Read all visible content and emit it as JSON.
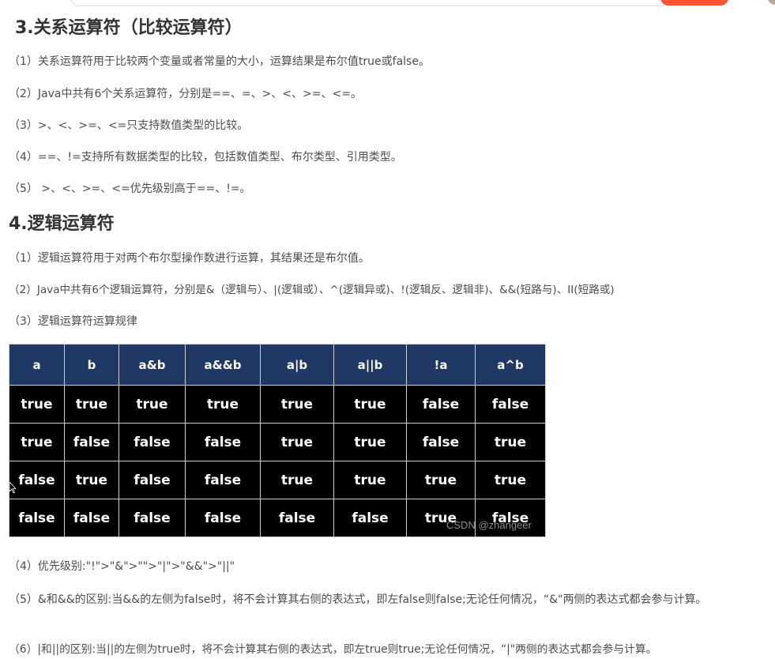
{
  "section3": {
    "heading": "3.关系运算符（比较运算符）",
    "points": [
      "（1）关系运算符用于比较两个变量或者常量的大小，运算结果是布尔值true或false。",
      "（2）Java中共有6个关系运算符，分别是==、=、>、<、>=、<=。",
      "（3）>、<、>=、<=只支持数值类型的比较。",
      "（4）==、!=支持所有数据类型的比较，包括数值类型、布尔类型、引用类型。",
      "（5） >、<、>=、<=优先级别高于==、!=。"
    ]
  },
  "section4": {
    "heading": "4.逻辑运算符",
    "points": [
      "（1）逻辑运算符用于对两个布尔型操作数进行运算，其结果还是布尔值。",
      "（2）Java中共有6个逻辑运算符，分别是&（逻辑与）、|(逻辑或）、^(逻辑异或)、!(逻辑反、逻辑非)、&&(短路与)、II(短路或)",
      "（3）逻辑运算符运算规律"
    ],
    "table": {
      "headers": [
        "a",
        "b",
        "a&b",
        "a&&b",
        "a|b",
        "a||b",
        "!a",
        "a^b"
      ],
      "rows": [
        [
          "true",
          "true",
          "true",
          "true",
          "true",
          "true",
          "false",
          "false"
        ],
        [
          "true",
          "false",
          "false",
          "false",
          "true",
          "true",
          "false",
          "true"
        ],
        [
          "false",
          "true",
          "false",
          "false",
          "true",
          "true",
          "true",
          "true"
        ],
        [
          "false",
          "false",
          "false",
          "false",
          "false",
          "false",
          "true",
          "false"
        ]
      ]
    },
    "watermark": "CSDN @zhangeer",
    "after_points": [
      "（4）优先级别:\"!\">\"&\">\"\">\"|\">\"&&\">\"||\"",
      "（5）&和&&的区别:当&&的左侧为false时，将不会计算其右侧的表达式，即左false则false;无论任何情况，“&\"两侧的表达式都会参与计算。",
      "（6）|和||的区别:当||的左侧为true时，将不会计算其右侧的表达式，即左true则true;无论任何情况，“|\"两侧的表达式都会参与计算。"
    ]
  },
  "colors": {
    "header_bg": "#203864",
    "cell_bg": "#000000",
    "search_button": "#fc5531"
  }
}
